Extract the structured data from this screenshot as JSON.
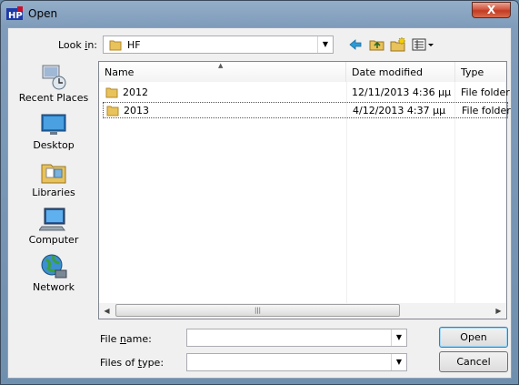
{
  "window": {
    "title": "Open",
    "close_label": "X"
  },
  "toolbar": {
    "lookin_label": "Look in:",
    "lookin_value": "HF",
    "back_icon": "back-arrow-icon",
    "up_icon": "folder-up-icon",
    "newfolder_icon": "new-folder-icon",
    "views_icon": "view-menu-icon"
  },
  "places": [
    {
      "label": "Recent Places",
      "icon": "recent-places-icon"
    },
    {
      "label": "Desktop",
      "icon": "desktop-icon"
    },
    {
      "label": "Libraries",
      "icon": "libraries-icon"
    },
    {
      "label": "Computer",
      "icon": "computer-icon"
    },
    {
      "label": "Network",
      "icon": "network-icon"
    }
  ],
  "list": {
    "columns": [
      "Name",
      "Date modified",
      "Type"
    ],
    "rows": [
      {
        "name": "2012",
        "date": "12/11/2013 4:36 μμ",
        "type": "File folder"
      },
      {
        "name": "2013",
        "date": "4/12/2013 4:37 μμ",
        "type": "File folder"
      }
    ]
  },
  "form": {
    "filename_label": "File name:",
    "filename_value": "",
    "filetype_label": "Files of type:",
    "filetype_value": "",
    "open_label": "Open",
    "cancel_label": "Cancel"
  },
  "colors": {
    "accent": "#3c7fb1",
    "close_red": "#c23b22",
    "folder_yellow": "#e8c25a"
  }
}
